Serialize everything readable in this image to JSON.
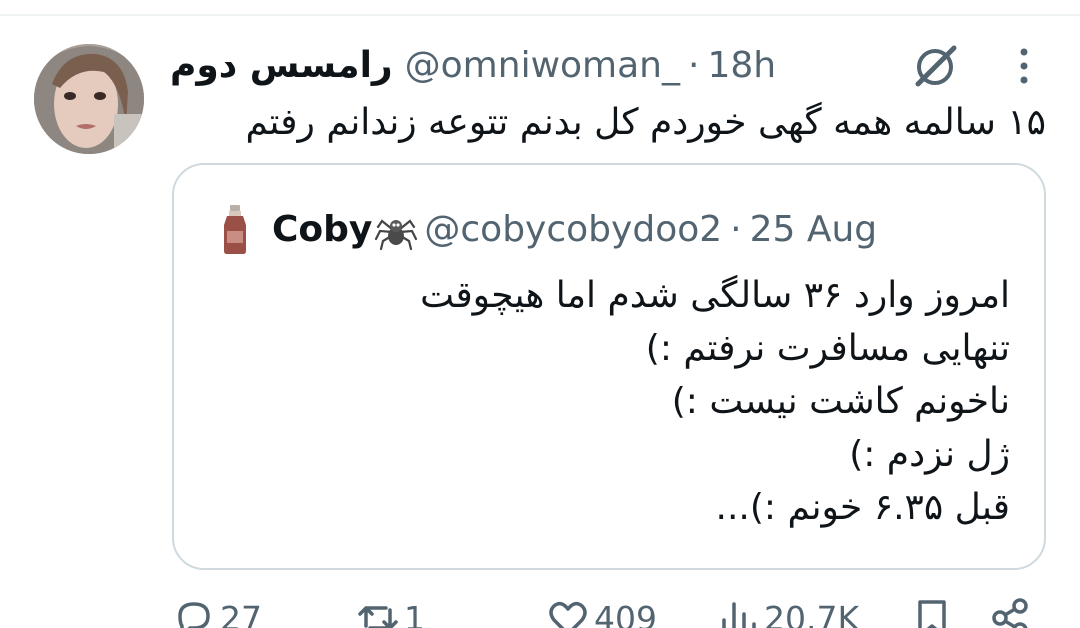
{
  "tweet": {
    "display_name": "رامسس دوم",
    "handle": "@omniwoman_",
    "separator": "·",
    "time": "18h",
    "text": "۱۵ سالمه همه گهی خوردم کل بدنم تتوعه زندانم رفتم"
  },
  "quote": {
    "name": "Coby",
    "handle": "@cobycobydoo2",
    "separator": "·",
    "date": "25 Aug",
    "lines": [
      "امروز وارد ۳۶ سالگی شدم اما هیچوقت",
      "تنهایی مسافرت نرفتم :)",
      "ناخونم کاشت نیست :)",
      "ژل نزدم :)",
      "قبل ۶.۳۵ خونم :)..."
    ]
  },
  "actions": {
    "replies": "27",
    "reposts": "1",
    "likes": "409",
    "views": "20.7K"
  },
  "icons": [
    "grok-icon",
    "more-icon",
    "spider-emoji",
    "bottle-avatar",
    "reply-icon",
    "repost-icon",
    "like-icon",
    "views-icon",
    "bookmark-icon",
    "share-icon"
  ],
  "colors": {
    "text": "#0f1419",
    "secondary": "#536471",
    "border": "#cfd9de",
    "divider": "#eff3f4"
  }
}
